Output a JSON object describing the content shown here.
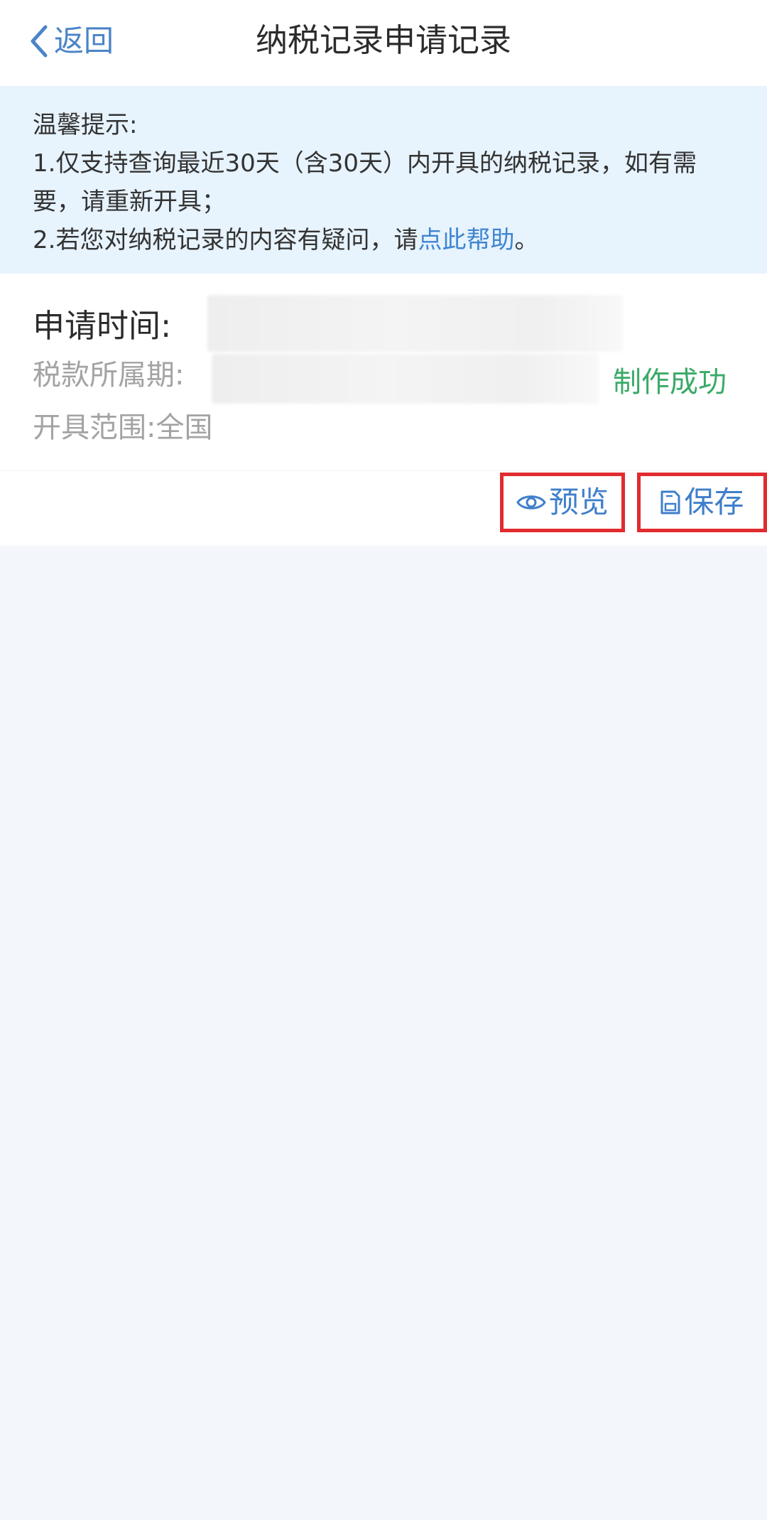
{
  "header": {
    "back_label": "返回",
    "title": "纳税记录申请记录"
  },
  "notice": {
    "heading": "温馨提示:",
    "line1": "1.仅支持查询最近30天（含30天）内开具的纳税记录，如有需要，请重新开具；",
    "line2_prefix": "2.若您对纳税记录的内容有疑问，请",
    "line2_link": "点此帮助",
    "line2_suffix": "。"
  },
  "record": {
    "apply_time_label": "申请时间:",
    "tax_period_label": "税款所属期:",
    "scope_label": "开具范围:",
    "scope_value": "全国",
    "status": "制作成功"
  },
  "actions": {
    "preview_label": "预览",
    "save_label": "保存"
  },
  "colors": {
    "accent_blue": "#4a84c8",
    "link_blue": "#3f85d1",
    "success_green": "#3aaa68",
    "highlight_red": "#e12b2f",
    "notice_bg": "#e7f3fd",
    "page_bg": "#f3f6fb"
  },
  "icons": {
    "back": "chevron-left-icon",
    "preview": "eye-icon",
    "save": "floppy-disk-icon"
  }
}
